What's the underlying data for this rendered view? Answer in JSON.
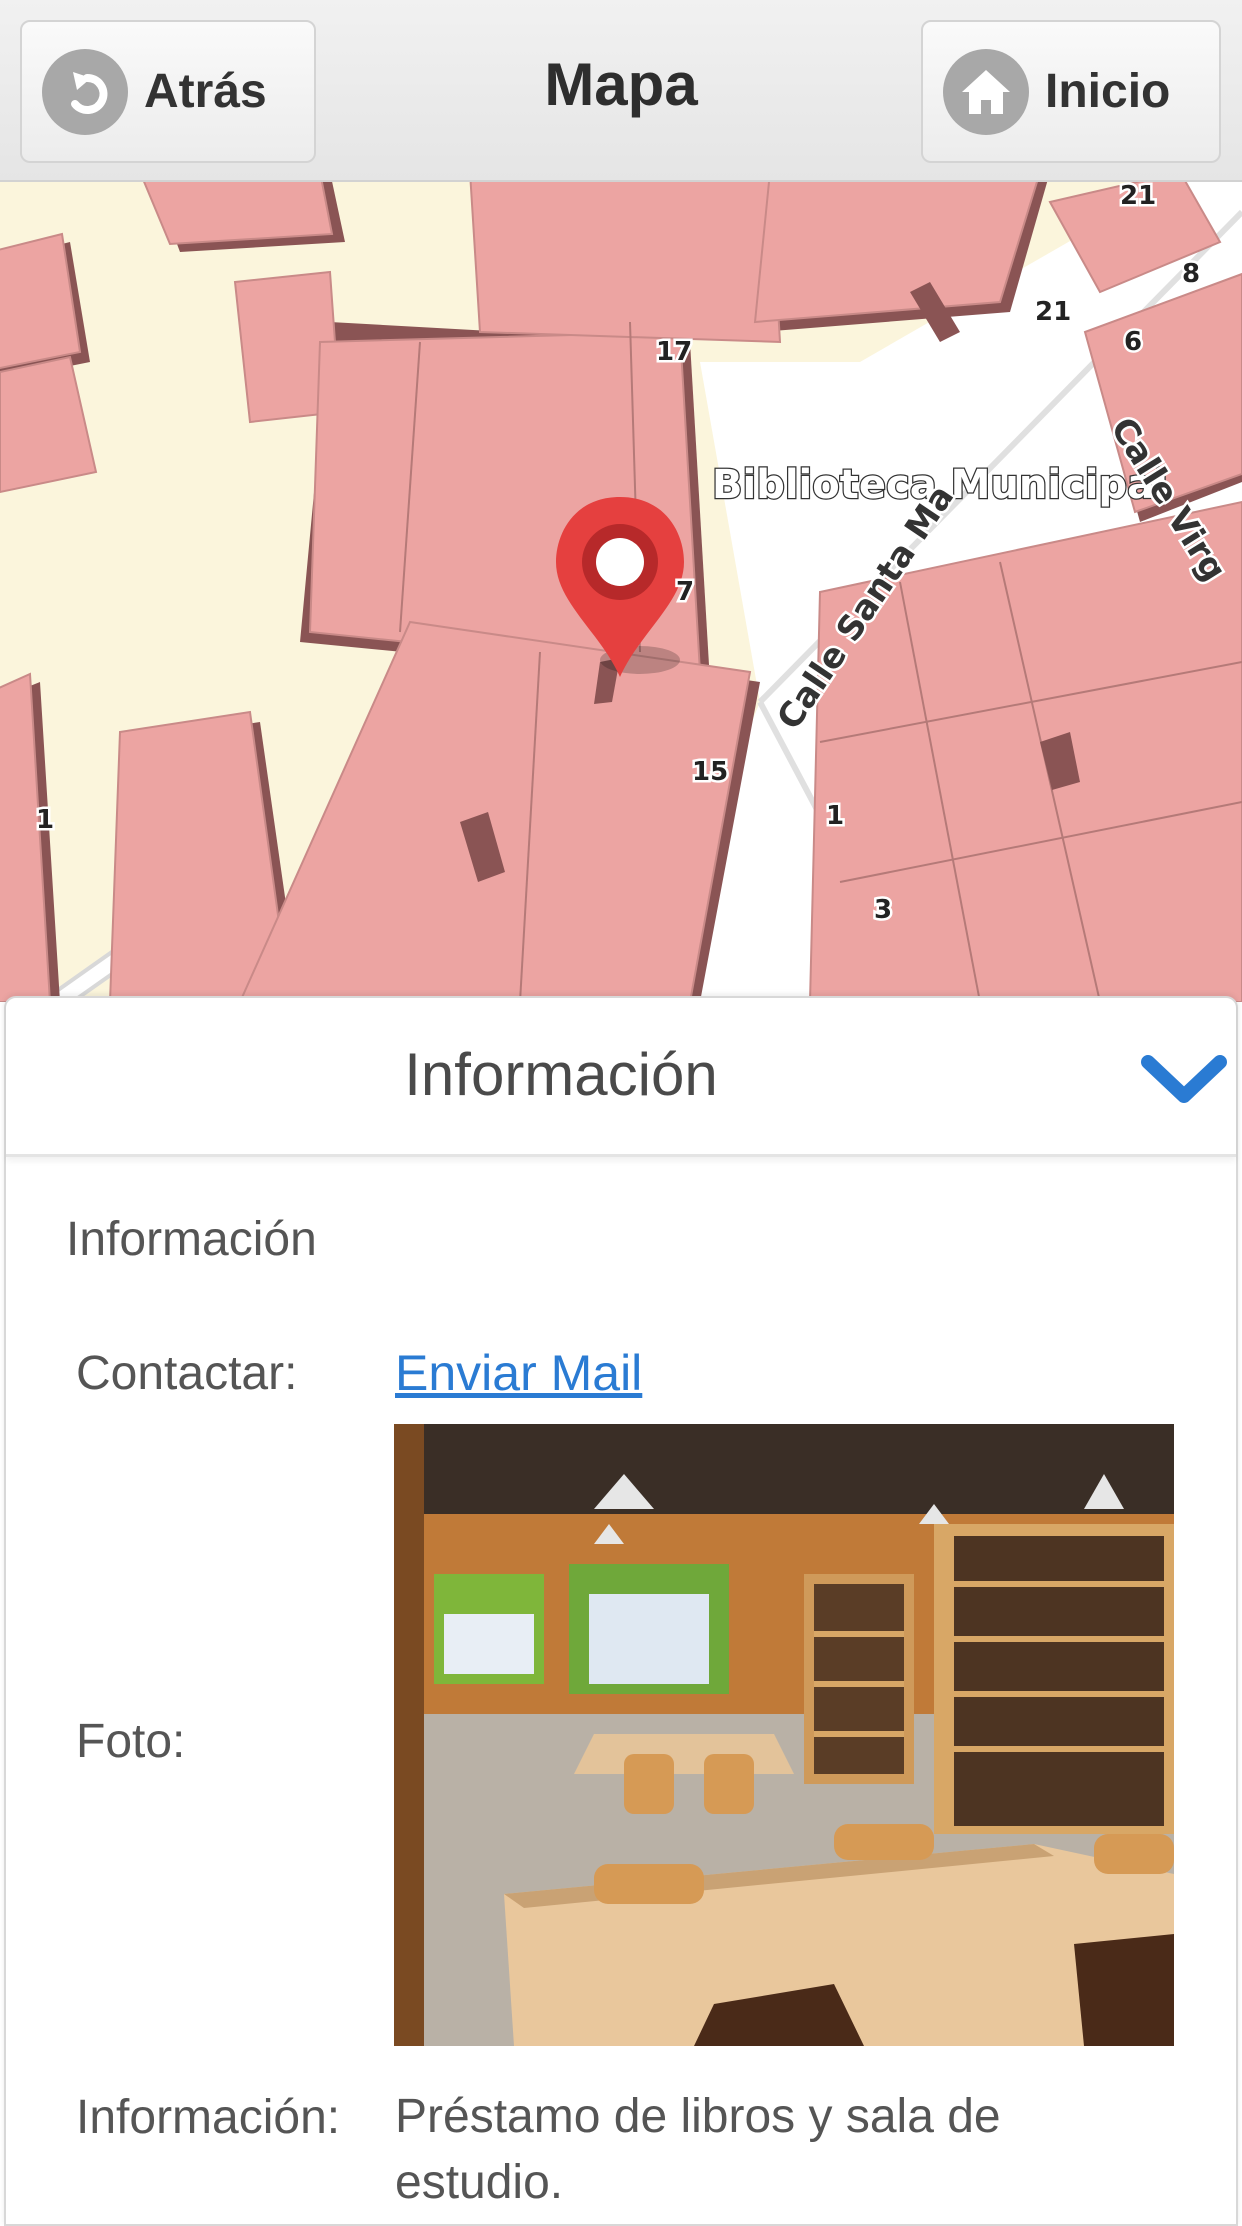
{
  "header": {
    "title": "Mapa",
    "back_label": "Atrás",
    "home_label": "Inicio",
    "back_icon": "back-arrow-icon",
    "home_icon": "home-icon"
  },
  "map": {
    "place_label": "Biblioteca Municipal",
    "street_labels": [
      "Calle Santa Ma",
      "Calle Virg"
    ],
    "house_numbers": [
      "21",
      "21",
      "8",
      "6",
      "17",
      "7",
      "15",
      "1",
      "1",
      "3"
    ],
    "marker_icon": "map-pin-icon",
    "colors": {
      "building": "#eca4a2",
      "building_shadow": "#8a5454",
      "ground": "#fbf5dc",
      "road": "#ffffff"
    }
  },
  "panel": {
    "title": "Información",
    "collapse_icon": "chevron-down-icon",
    "section_title": "Información",
    "rows": {
      "contact_label": "Contactar:",
      "contact_link": "Enviar Mail",
      "photo_label": "Foto:",
      "info_label": "Información:",
      "info_value": "Préstamo de libros y sala de estudio."
    },
    "accent_color": "#2a7bd3"
  }
}
